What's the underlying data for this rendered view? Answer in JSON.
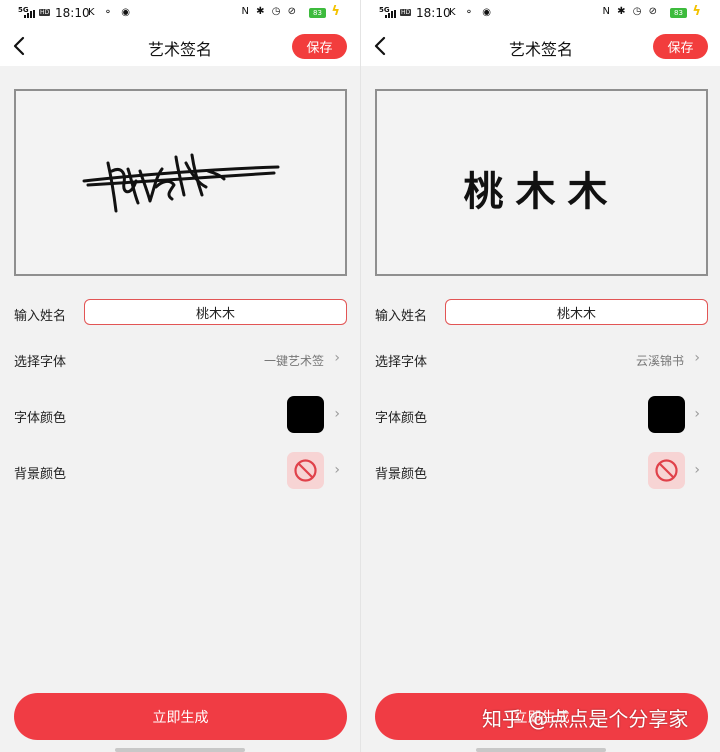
{
  "left": {
    "status": {
      "network": "5G",
      "hd": "HD",
      "time": "18:10",
      "left_icons": "K ⚬ ◉",
      "right_icons": "N ✱ ◷ ⊘",
      "battery": "83"
    },
    "header": {
      "title": "艺术签名",
      "save_label": "保存"
    },
    "signature_preview": {
      "style": "一键艺术签",
      "text": "桃木木"
    },
    "form": {
      "name_label": "输入姓名",
      "name_value": "桃木木",
      "font_label": "选择字体",
      "font_value": "一键艺术签",
      "color_label": "字体颜色",
      "font_color": "#000000",
      "bg_label": "背景颜色",
      "bg_color": "none"
    },
    "generate_label": "立即生成"
  },
  "right": {
    "status": {
      "network": "5G",
      "hd": "HD",
      "time": "18:10",
      "left_icons": "K ⚬ ◉",
      "right_icons": "N ✱ ◷ ⊘",
      "battery": "83"
    },
    "header": {
      "title": "艺术签名",
      "save_label": "保存"
    },
    "signature_preview": {
      "text": "桃木木"
    },
    "form": {
      "name_label": "输入姓名",
      "name_value": "桃木木",
      "font_label": "选择字体",
      "font_value": "云溪锦书",
      "color_label": "字体颜色",
      "font_color": "#000000",
      "bg_label": "背景颜色",
      "bg_color": "none"
    },
    "generate_label": "立即生成"
  },
  "watermark": "知乎 @点点是个分享家",
  "colors": {
    "accent": "#f23d3d",
    "input_border": "#e25555",
    "page_bg": "#f2f2f2"
  },
  "icons": {
    "back": "chevron-left-icon",
    "row_arrow": "chevron-right-icon",
    "no_background": "prohibited-icon"
  }
}
